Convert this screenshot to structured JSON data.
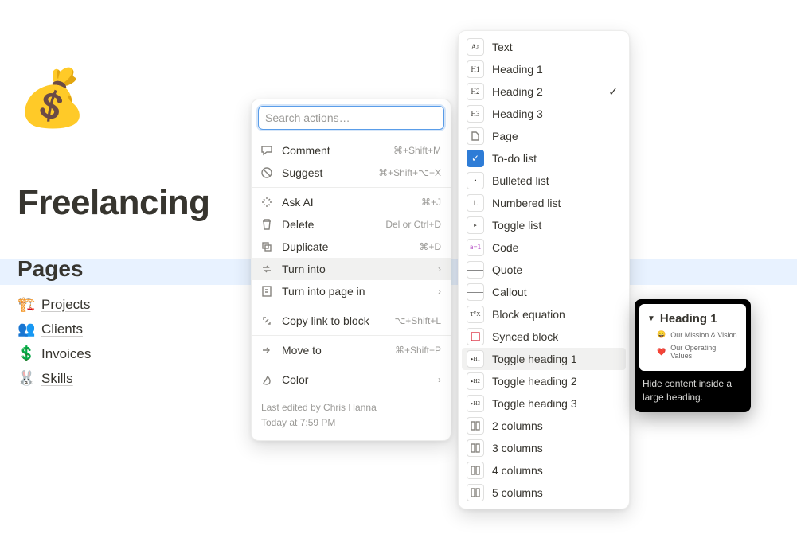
{
  "page": {
    "icon": "💰",
    "title": "Freelancing",
    "section_header": "Pages",
    "items": [
      {
        "emoji": "🏗️",
        "label": "Projects"
      },
      {
        "emoji": "👥",
        "label": "Clients"
      },
      {
        "emoji": "💲",
        "label": "Invoices"
      },
      {
        "emoji": "🐰",
        "label": "Skills"
      }
    ]
  },
  "action_menu": {
    "search_placeholder": "Search actions…",
    "groups": [
      [
        {
          "icon": "comment",
          "label": "Comment",
          "shortcut": "⌘+Shift+M"
        },
        {
          "icon": "suggest",
          "label": "Suggest",
          "shortcut": "⌘+Shift+⌥+X"
        }
      ],
      [
        {
          "icon": "ai",
          "label": "Ask AI",
          "shortcut": "⌘+J"
        },
        {
          "icon": "trash",
          "label": "Delete",
          "shortcut": "Del or Ctrl+D"
        },
        {
          "icon": "duplicate",
          "label": "Duplicate",
          "shortcut": "⌘+D"
        },
        {
          "icon": "turninto",
          "label": "Turn into",
          "chevron": true,
          "highlight": true
        },
        {
          "icon": "pagein",
          "label": "Turn into page in",
          "chevron": true
        }
      ],
      [
        {
          "icon": "link",
          "label": "Copy link to block",
          "shortcut": "⌥+Shift+L"
        }
      ],
      [
        {
          "icon": "moveto",
          "label": "Move to",
          "shortcut": "⌘+Shift+P"
        }
      ],
      [
        {
          "icon": "color",
          "label": "Color",
          "chevron": true
        }
      ]
    ],
    "footer_line1": "Last edited by Chris Hanna",
    "footer_line2": "Today at 7:59 PM"
  },
  "turn_into": {
    "items": [
      {
        "glyph": "Aa",
        "label": "Text"
      },
      {
        "glyph": "H1",
        "label": "Heading 1"
      },
      {
        "glyph": "H2",
        "label": "Heading 2",
        "checked": true
      },
      {
        "glyph": "H3",
        "label": "Heading 3"
      },
      {
        "glyph": "pg",
        "label": "Page"
      },
      {
        "glyph": "todo",
        "label": "To-do list"
      },
      {
        "glyph": "•",
        "label": "Bulleted list"
      },
      {
        "glyph": "1.",
        "label": "Numbered list"
      },
      {
        "glyph": "▸",
        "label": "Toggle list"
      },
      {
        "glyph": "code",
        "label": "Code"
      },
      {
        "glyph": "lines",
        "label": "Quote"
      },
      {
        "glyph": "lines",
        "label": "Callout"
      },
      {
        "glyph": "TeX",
        "label": "Block equation"
      },
      {
        "glyph": "sync",
        "label": "Synced block"
      },
      {
        "glyph": "▸H1",
        "label": "Toggle heading 1",
        "highlight": true
      },
      {
        "glyph": "▸H2",
        "label": "Toggle heading 2"
      },
      {
        "glyph": "▸H3",
        "label": "Toggle heading 3"
      },
      {
        "glyph": "cols",
        "label": "2 columns"
      },
      {
        "glyph": "cols",
        "label": "3 columns"
      },
      {
        "glyph": "cols",
        "label": "4 columns"
      },
      {
        "glyph": "cols",
        "label": "5 columns"
      }
    ]
  },
  "tooltip": {
    "preview_title": "Heading 1",
    "preview_rows": [
      {
        "emoji": "😀",
        "text": "Our Mission & Vision"
      },
      {
        "emoji": "❤️",
        "text": "Our Operating Values"
      }
    ],
    "description": "Hide content inside a large heading."
  }
}
